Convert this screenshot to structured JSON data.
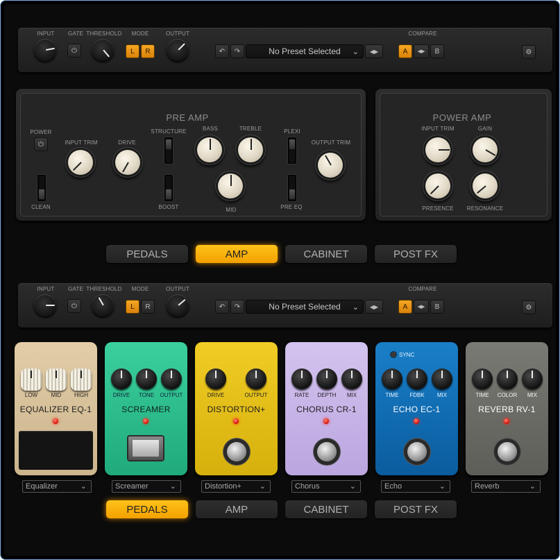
{
  "header": {
    "input_label": "INPUT",
    "gate_label": "GATE",
    "threshold_label": "THRESHOLD",
    "mode_label": "MODE",
    "output_label": "OUTPUT",
    "compare_label": "COMPARE",
    "mode_left": "L",
    "mode_right": "R",
    "preset_name": "No Preset Selected",
    "compare_a": "A",
    "compare_b": "B"
  },
  "preamp": {
    "title": "PRE AMP",
    "power_label": "POWER",
    "clean_label": "CLEAN",
    "input_trim_label": "INPUT TRIM",
    "drive_label": "DRIVE",
    "structure_label": "STRUCTURE",
    "boost_label": "BOOST",
    "bass_label": "BASS",
    "treble_label": "TREBLE",
    "mid_label": "MID",
    "plexi_label": "PLEXI",
    "pre_eq_label": "PRE EQ",
    "output_trim_label": "OUTPUT TRIM"
  },
  "poweramp": {
    "title": "POWER AMP",
    "input_trim_label": "INPUT TRIM",
    "gain_label": "GAIN",
    "presence_label": "PRESENCE",
    "resonance_label": "RESONANCE"
  },
  "tabs": [
    "PEDALS",
    "AMP",
    "CABINET",
    "POST FX"
  ],
  "pedals": [
    {
      "name": "EQUALIZER EQ-1",
      "knobs": [
        "LOW",
        "MID",
        "HIGH"
      ],
      "select": "Equalizer",
      "color": "#d4bd97"
    },
    {
      "name": "SCREAMER",
      "knobs": [
        "DRIVE",
        "TONE",
        "OUTPUT"
      ],
      "select": "Screamer",
      "color": "#2fc190"
    },
    {
      "name": "DISTORTION+",
      "knobs": [
        "DRIVE",
        "OUTPUT"
      ],
      "select": "Distortion+",
      "color": "#e9c41a"
    },
    {
      "name": "CHORUS CR-1",
      "knobs": [
        "RATE",
        "DEPTH",
        "MIX"
      ],
      "select": "Chorus",
      "color": "#c8b6e8"
    },
    {
      "name": "ECHO EC-1",
      "knobs": [
        "TIME",
        "FDBK",
        "MIX"
      ],
      "select": "Echo",
      "color": "#0f6fb8",
      "sync_label": "SYNC"
    },
    {
      "name": "REVERB RV-1",
      "knobs": [
        "TIME",
        "COLOR",
        "MIX"
      ],
      "select": "Reverb",
      "color": "#6b6b66"
    }
  ]
}
